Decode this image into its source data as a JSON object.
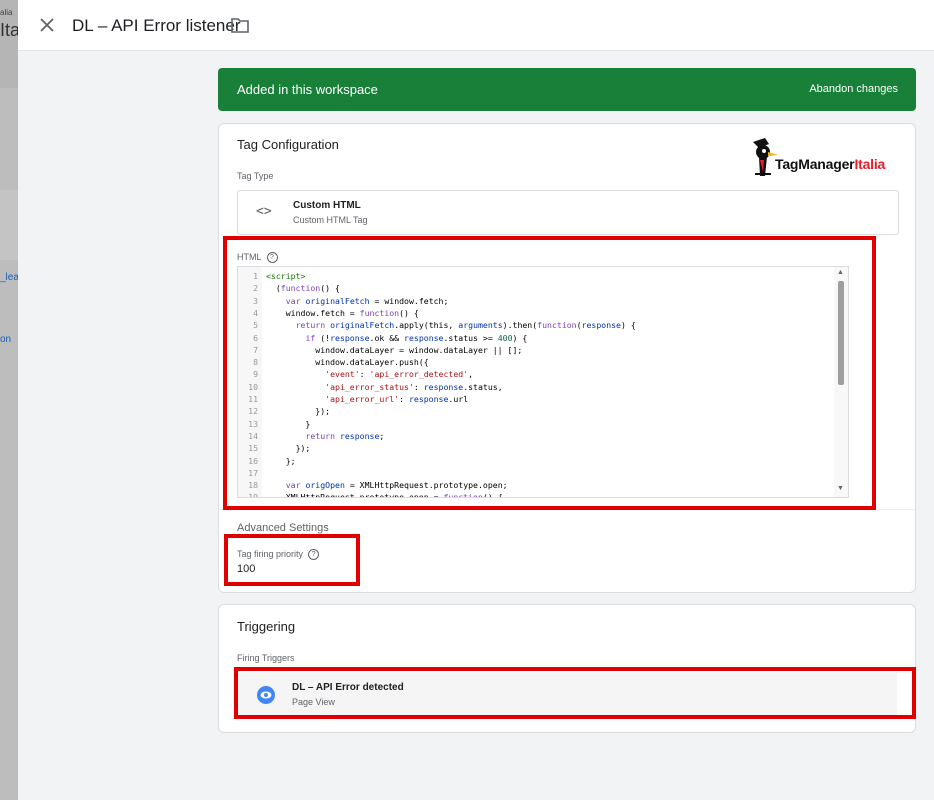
{
  "background_fragments": {
    "f1": "alia",
    "f2": "Ita",
    "f3": "_lea",
    "f4": "on"
  },
  "header": {
    "title": "DL – API Error listener",
    "close_icon": "close-icon",
    "folder_icon": "folder-icon"
  },
  "banner": {
    "text": "Added in this workspace",
    "action": "Abandon changes",
    "color": "#188038"
  },
  "tag_configuration": {
    "title": "Tag Configuration",
    "logo_text_main": "TagManager",
    "logo_text_accent": "Italia",
    "tag_type_label": "Tag Type",
    "tag_type_name": "Custom HTML",
    "tag_type_sub": "Custom HTML Tag",
    "html_label": "HTML",
    "code_lines": [
      "<script>",
      "  (function() {",
      "    var originalFetch = window.fetch;",
      "    window.fetch = function() {",
      "      return originalFetch.apply(this, arguments).then(function(response) {",
      "        if (!response.ok && response.status >= 400) {",
      "          window.dataLayer = window.dataLayer || [];",
      "          window.dataLayer.push({",
      "            'event': 'api_error_detected',",
      "            'api_error_status': response.status,",
      "            'api_error_url': response.url",
      "          });",
      "        }",
      "        return response;",
      "      });",
      "    };",
      "",
      "    var origOpen = XMLHttpRequest.prototype.open;",
      "    XMLHttpRequest.prototype.open = function() {"
    ],
    "advanced_settings_label": "Advanced Settings",
    "priority_label": "Tag firing priority",
    "priority_value": "100"
  },
  "triggering": {
    "title": "Triggering",
    "firing_label": "Firing Triggers",
    "trigger_name": "DL – API Error detected",
    "trigger_type": "Page View",
    "trigger_icon": "eye-icon"
  },
  "colors": {
    "highlight": "#e00000",
    "accent_blue": "#4285f4"
  }
}
